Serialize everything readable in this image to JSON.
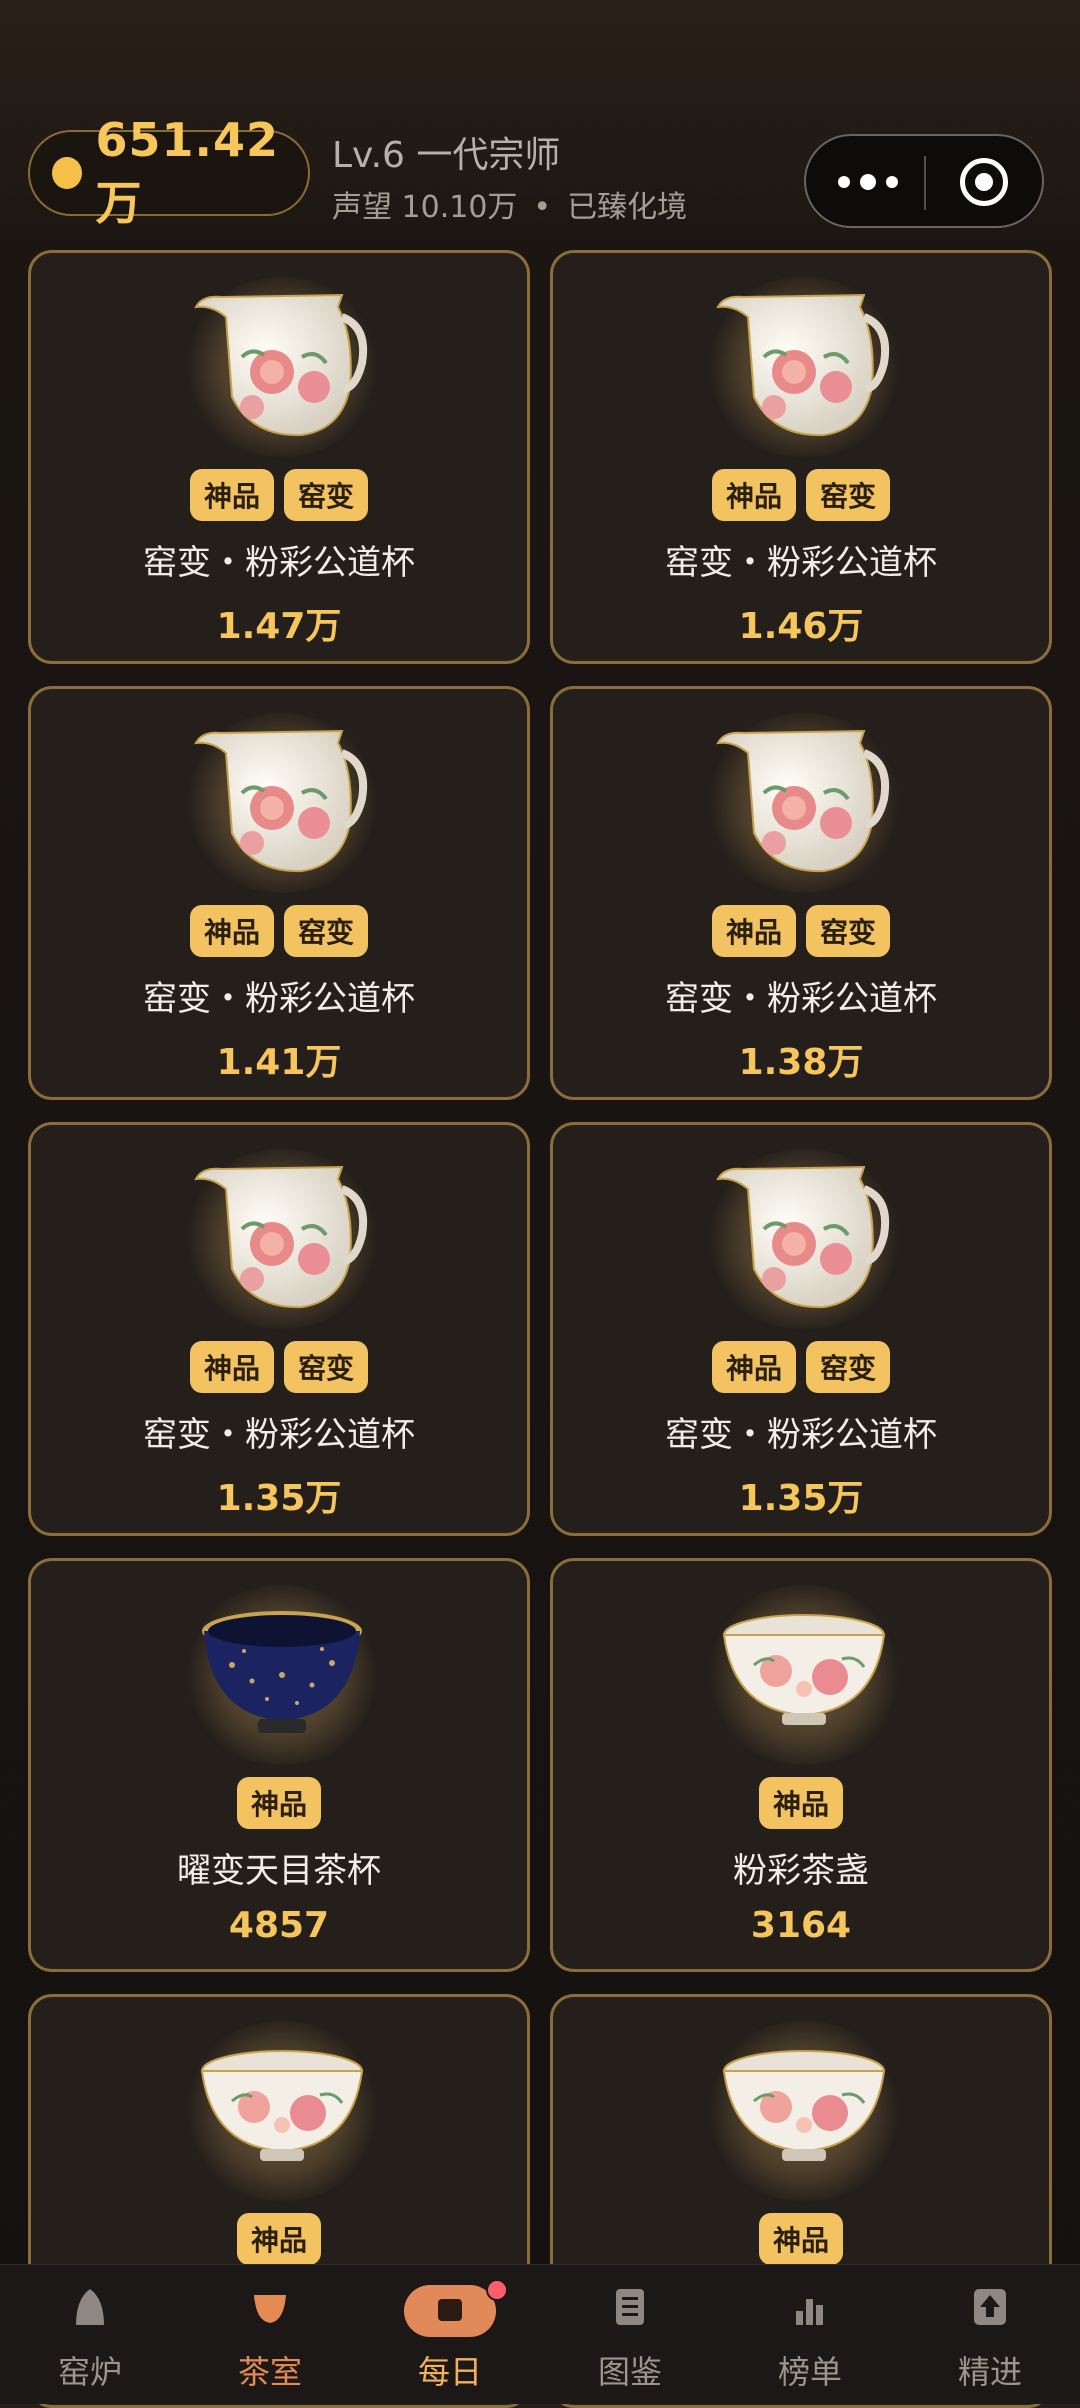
{
  "header": {
    "coins": "651.42万",
    "level": "Lv.6 一代宗师",
    "reputation": "声望 10.10万",
    "separator": "•",
    "status": "已臻化境"
  },
  "items": [
    {
      "tags": [
        "神品",
        "窑变"
      ],
      "name": "窑变・粉彩公道杯",
      "price": "1.47万",
      "kind": "pitcher"
    },
    {
      "tags": [
        "神品",
        "窑变"
      ],
      "name": "窑变・粉彩公道杯",
      "price": "1.46万",
      "kind": "pitcher"
    },
    {
      "tags": [
        "神品",
        "窑变"
      ],
      "name": "窑变・粉彩公道杯",
      "price": "1.41万",
      "kind": "pitcher"
    },
    {
      "tags": [
        "神品",
        "窑变"
      ],
      "name": "窑变・粉彩公道杯",
      "price": "1.38万",
      "kind": "pitcher"
    },
    {
      "tags": [
        "神品",
        "窑变"
      ],
      "name": "窑变・粉彩公道杯",
      "price": "1.35万",
      "kind": "pitcher"
    },
    {
      "tags": [
        "神品",
        "窑变"
      ],
      "name": "窑变・粉彩公道杯",
      "price": "1.35万",
      "kind": "pitcher"
    },
    {
      "tags": [
        "神品"
      ],
      "name": "曜变天目茶杯",
      "price": "4857",
      "kind": "tenmoku"
    },
    {
      "tags": [
        "神品"
      ],
      "name": "粉彩茶盏",
      "price": "3164",
      "kind": "bowl"
    },
    {
      "tags": [
        "神品"
      ],
      "name": "",
      "price": "",
      "kind": "bowl"
    },
    {
      "tags": [
        "神品"
      ],
      "name": "",
      "price": "",
      "kind": "bowl"
    }
  ],
  "nav": [
    {
      "label": "窑炉",
      "icon": "kiln-icon"
    },
    {
      "label": "茶室",
      "icon": "teacup-icon",
      "active": true
    },
    {
      "label": "每日",
      "icon": "daily-gift-icon",
      "badge": true
    },
    {
      "label": "图鉴",
      "icon": "catalog-icon"
    },
    {
      "label": "榜单",
      "icon": "ranking-icon"
    },
    {
      "label": "精进",
      "icon": "upgrade-icon"
    }
  ],
  "colors": {
    "accent": "#f6c55c",
    "card_border": "#8a6d3a",
    "active_tab": "#e48a52",
    "badge": "#ff5c6c"
  }
}
